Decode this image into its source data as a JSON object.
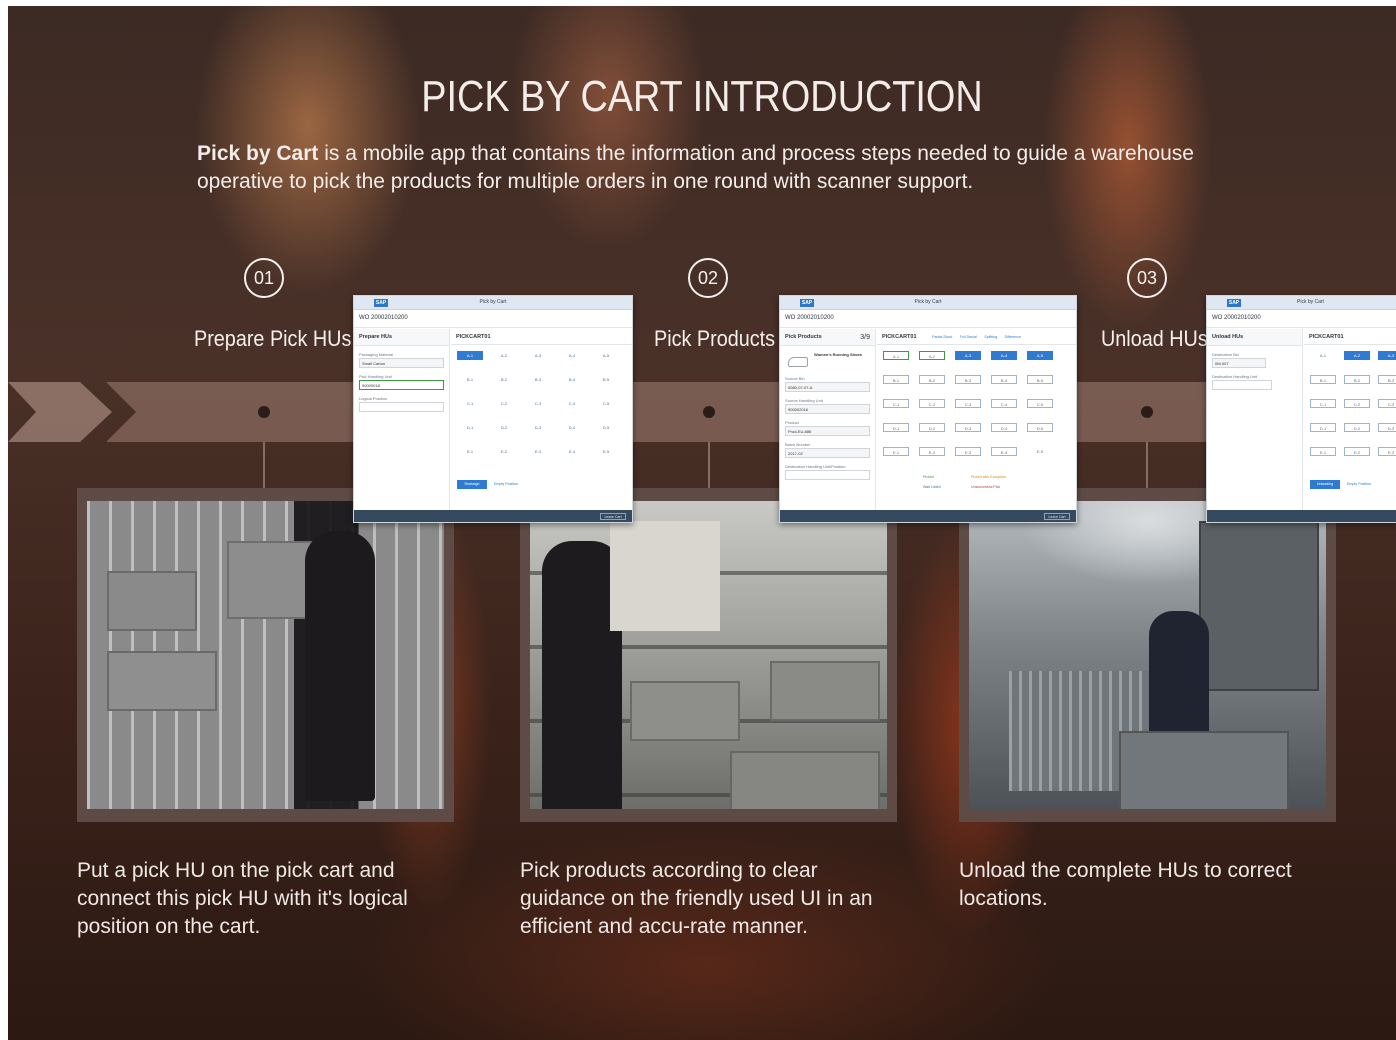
{
  "title": "PICK BY CART INTRODUCTION",
  "intro": {
    "bold": "Pick by Cart",
    "text": " is a mobile app that contains the information and process steps needed to guide a warehouse operative to pick the products for multiple orders in one round with scanner support."
  },
  "steps": [
    {
      "number": "01",
      "label": "Prepare Pick HUs",
      "caption": "Put a pick HU on the pick cart and connect this pick HU with it's logical position on the cart.",
      "app": {
        "bar_title": "Pick by Cart",
        "wo": "WO 20002010200",
        "left_header": "Prepare HUs",
        "fields": [
          {
            "label": "Packaging Material",
            "value": "Small Carton"
          },
          {
            "label": "Pick Handling Unit",
            "value": "90000018"
          },
          {
            "label": "Logical Position",
            "value": ""
          }
        ],
        "right_header": "PICKCART01",
        "grid": [
          "A-1",
          "A-2",
          "A-3",
          "A-4",
          "A-5",
          "B-1",
          "B-2",
          "B-3",
          "B-4",
          "B-5",
          "C-1",
          "C-2",
          "C-3",
          "C-4",
          "C-5",
          "D-1",
          "D-2",
          "D-3",
          "D-4",
          "D-5",
          "E-1",
          "E-2",
          "E-3",
          "E-4",
          "E-5"
        ],
        "actions": [
          "Reassign",
          "Empty Position"
        ],
        "footer_button": "Leave Cart"
      }
    },
    {
      "number": "02",
      "label": "Pick Products",
      "caption": "Pick products according to clear guidance on the friendly used UI in an efficient and accu-rate manner.",
      "app": {
        "bar_title": "Pick by Cart",
        "wo": "WO 20002010200",
        "left_header": "Pick Products",
        "progress": "3/9",
        "product": "Women's Running Shoes",
        "fields": [
          {
            "label": "Source Bin",
            "value": "0080-07-07-A"
          },
          {
            "label": "Source Handling Unit",
            "value": "900002016"
          },
          {
            "label": "Product",
            "value": "Prod-EU-886"
          },
          {
            "label": "Batch Number",
            "value": "2017-02"
          },
          {
            "label": "Destination Handling Unit/Position",
            "value": ""
          }
        ],
        "right_header": "PICKCART01",
        "tabs": [
          "Partial Stock",
          "Full Denial",
          "Splitting",
          "Difference"
        ],
        "legend": [
          "Picked",
          "Picked with Exception",
          "Wait Listed",
          "Unsuccessful Pick"
        ],
        "footer_button": "Leave Cart"
      }
    },
    {
      "number": "03",
      "label": "Unload HUs",
      "caption": "Unload the complete HUs to correct locations.",
      "app": {
        "bar_title": "Pick by Cart",
        "wo": "WO 20002010200",
        "left_header": "Unload HUs",
        "fields": [
          {
            "label": "Destination Bin",
            "value": "0M-007"
          },
          {
            "label": "Destination Handling Unit",
            "value": ""
          }
        ],
        "right_header": "PICKCART01",
        "actions": [
          "Unloading",
          "Empty Position"
        ]
      }
    }
  ],
  "colors": {
    "accent": "#2f7bd1",
    "background": "#3c2a24",
    "text": "#f3ece8"
  }
}
